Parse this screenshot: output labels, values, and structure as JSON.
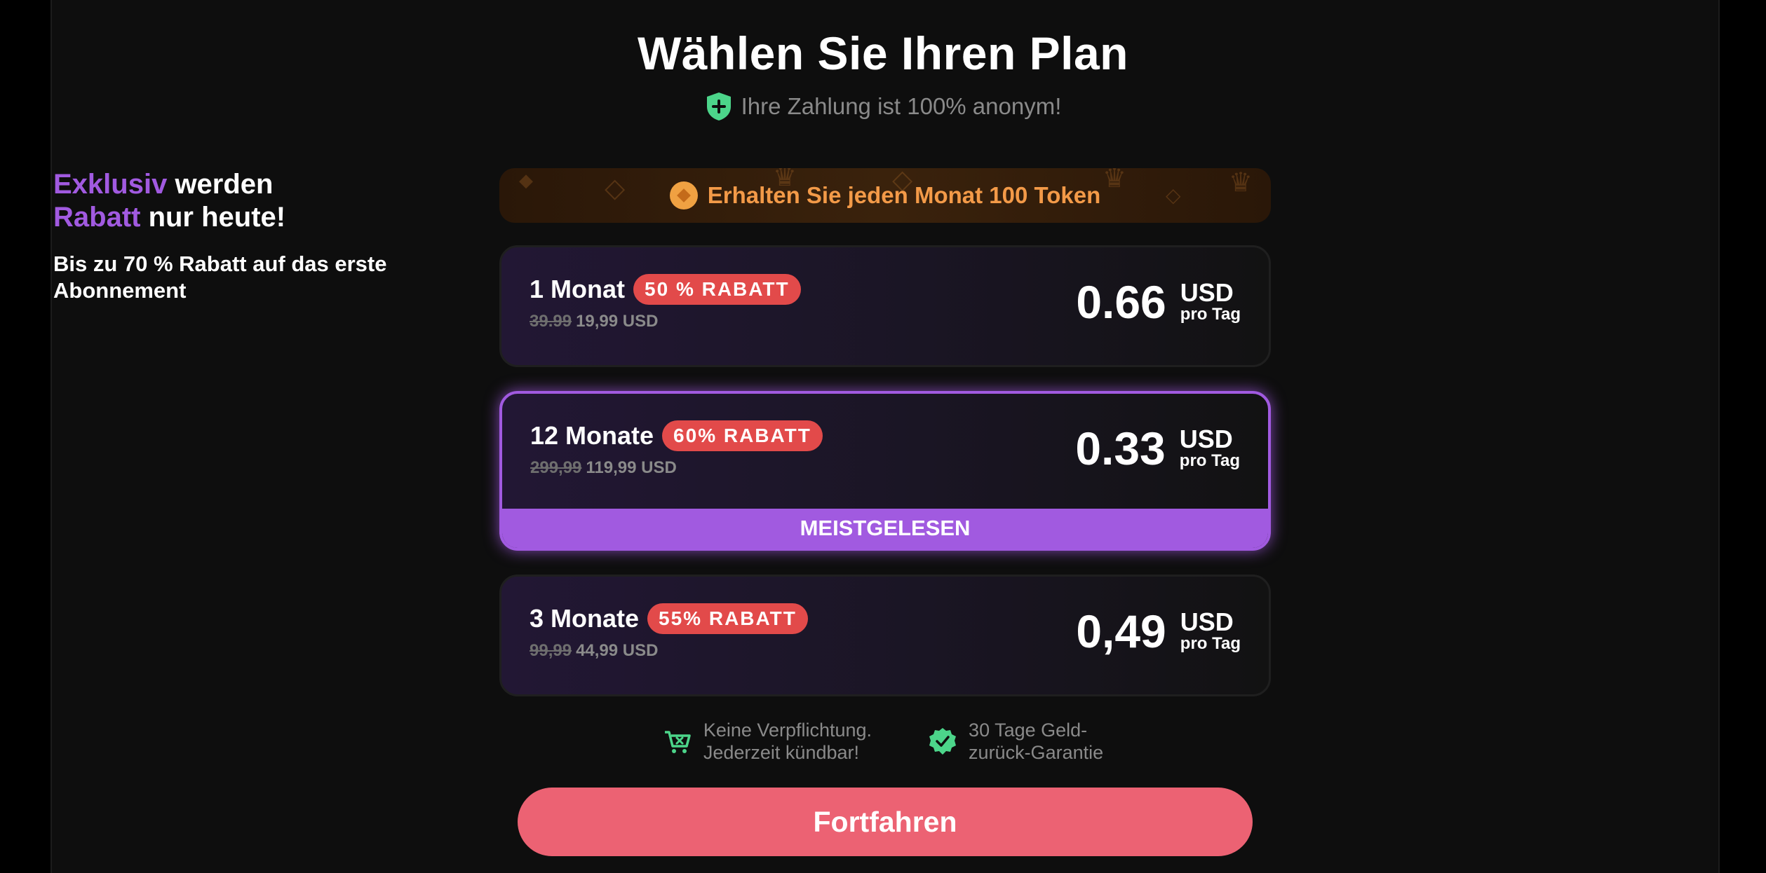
{
  "header": {
    "title": "Wählen Sie Ihren Plan",
    "subtitle": "Ihre Zahlung ist 100% anonym!"
  },
  "promo": {
    "line1_highlight": "Exklusiv",
    "line1_rest": " werden",
    "line2_highlight": "Rabatt",
    "line2_rest": " nur heute!",
    "sub": "Bis zu 70 % Rabatt auf das erste Abonnement"
  },
  "token_banner": {
    "text": "Erhalten Sie jeden Monat 100 Token"
  },
  "plans": [
    {
      "name": "1 Monat",
      "badge": "50 % RABATT",
      "old_price": "39.99",
      "new_price": "19,99 USD",
      "daily": "0.66",
      "currency": "USD",
      "per": "pro Tag"
    },
    {
      "name": "12 Monate",
      "badge": "60% RABATT",
      "old_price": "299,99",
      "new_price": "119,99 USD",
      "daily": "0.33",
      "currency": "USD",
      "per": "pro Tag",
      "ribbon": "MEISTGELESEN",
      "selected": true
    },
    {
      "name": "3 Monate",
      "badge": "55% RABATT",
      "old_price": "99,99",
      "new_price": "44,99 USD",
      "daily": "0,49",
      "currency": "USD",
      "per": "pro Tag"
    }
  ],
  "guarantees": [
    {
      "icon": "cart-x-icon",
      "line1": "Keine Verpflichtung.",
      "line2": "Jederzeit kündbar!"
    },
    {
      "icon": "check-badge-icon",
      "line1": "30 Tage Geld-",
      "line2": "zurück-Garantie"
    }
  ],
  "cta": {
    "label": "Fortfahren"
  },
  "colors": {
    "accent_purple": "#a15ae0",
    "badge_red": "#e24a4a",
    "cta_pink": "#ec6273",
    "token_orange": "#f39a48",
    "icon_green": "#4cd58a"
  }
}
